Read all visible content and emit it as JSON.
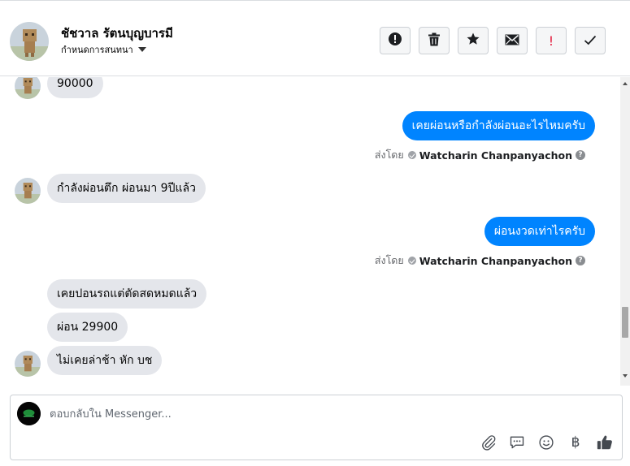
{
  "header": {
    "contact_name": "ชัชวาล รัตนบุญบารมี",
    "assign_label": "กำหนดการสนทนา",
    "tools": [
      "alert-icon",
      "trash-icon",
      "star-icon",
      "envelope-icon",
      "important-icon",
      "check-icon"
    ],
    "important_mark": "!"
  },
  "messages": [
    {
      "side": "in",
      "text": "90000"
    },
    {
      "side": "out",
      "text": "เคยผ่อนหรือกำลังผ่อนอะไรไหมครับ",
      "sent_by_label": "ส่งโดย",
      "sender": "Watcharin Chanpanyachon",
      "help": "?"
    },
    {
      "side": "in",
      "text": "กำลังผ่อนตึก  ผ่อนมา 9ปีแล้ว"
    },
    {
      "side": "out",
      "text": "ผ่อนงวดเท่าไรครับ",
      "sent_by_label": "ส่งโดย",
      "sender": "Watcharin Chanpanyachon",
      "help": "?"
    },
    {
      "side": "in",
      "text": "เคยปอนรถแต่ตัดสดหมดแล้ว"
    },
    {
      "side": "in",
      "text": "ผ่อน 29900"
    },
    {
      "side": "in",
      "text": "ไม่เคยล่าช้า  หัก  บช"
    }
  ],
  "composer": {
    "placeholder": "ตอบกลับใน Messenger...",
    "currency_symbol": "฿",
    "icons": [
      "paperclip-icon",
      "saved-reply-icon",
      "emoji-icon",
      "baht-icon",
      "like-icon"
    ]
  },
  "colors": {
    "outgoing_bubble": "#0084ff",
    "incoming_bubble": "#e4e6eb",
    "important_red": "#e41e3f"
  }
}
